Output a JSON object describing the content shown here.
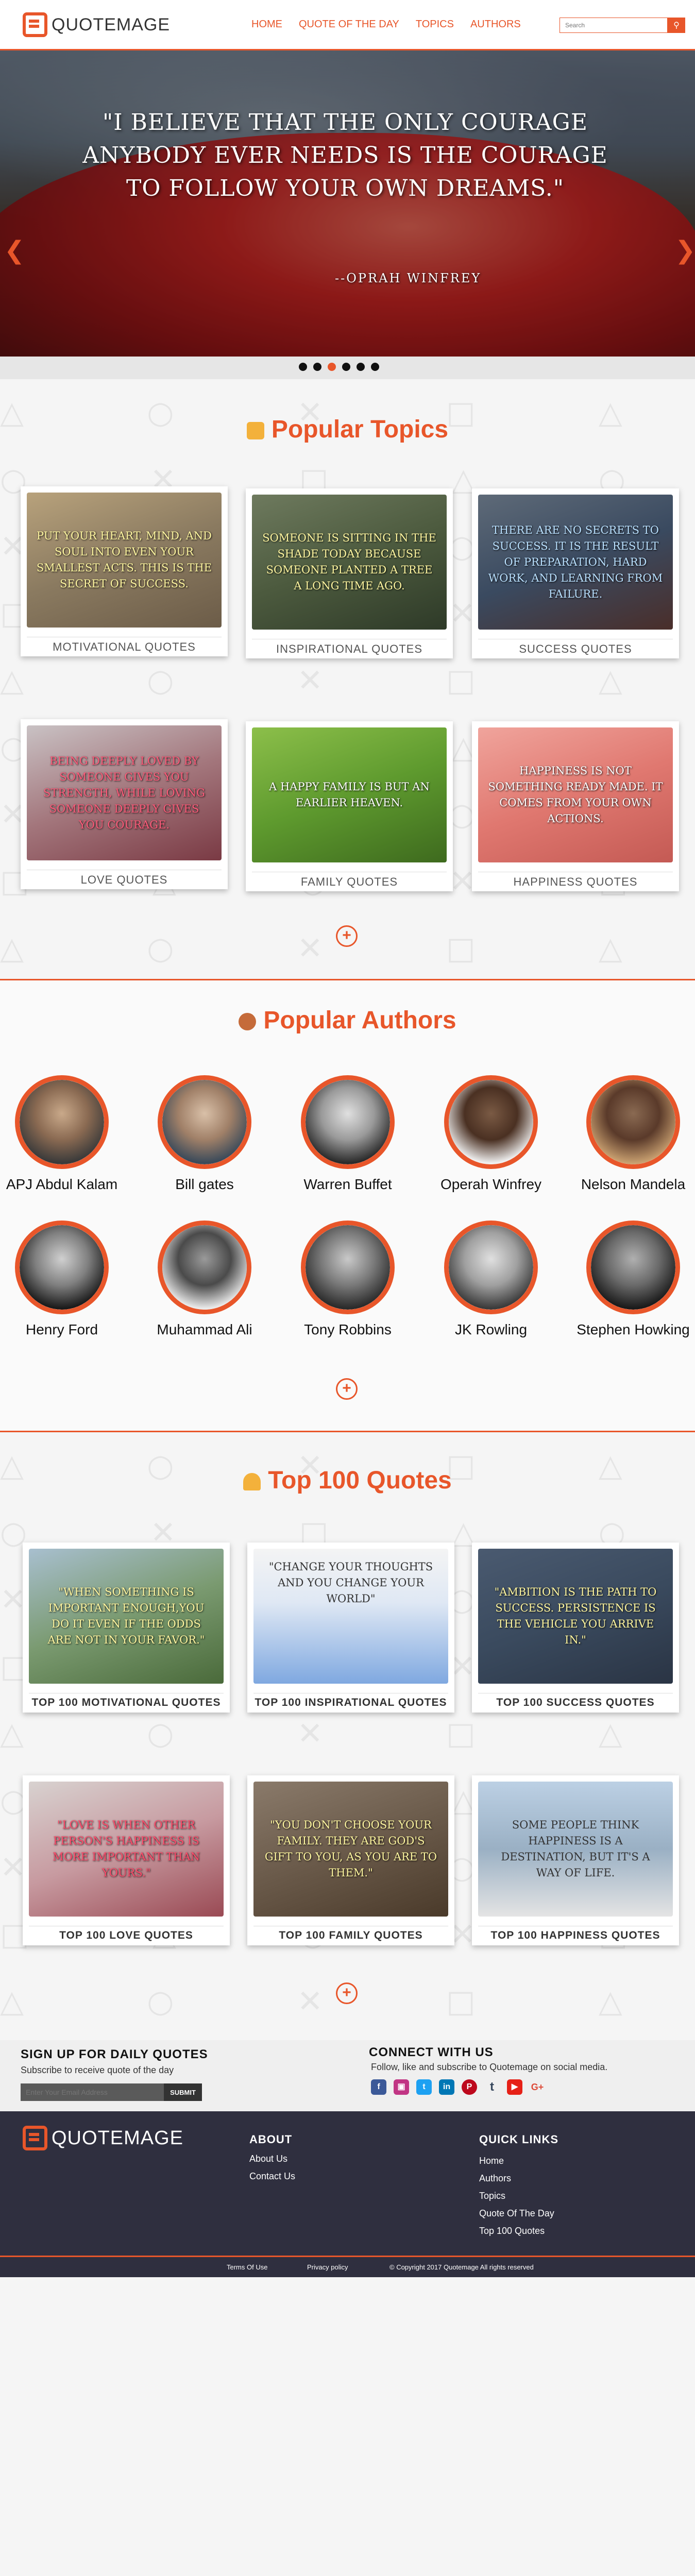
{
  "header": {
    "brand": "QUOTEMAGE",
    "nav": [
      "HOME",
      "QUOTE OF THE DAY",
      "TOPICS",
      "AUTHORS"
    ],
    "search_placeholder": "Search",
    "search_icon": "search-icon"
  },
  "hero": {
    "quote": "\"I BELIEVE THAT THE ONLY COURAGE ANYBODY EVER NEEDS IS THE COURAGE TO FOLLOW YOUR OWN DREAMS.\"",
    "author": "--OPRAH WINFREY",
    "slides_count": 6,
    "active_slide": 3
  },
  "topics": {
    "title": "Popular Topics",
    "cards": [
      {
        "text": "PUT YOUR HEART, MIND, AND SOUL INTO EVEN YOUR SMALLEST ACTS. THIS IS THE SECRET OF SUCCESS.",
        "label": "MOTIVATIONAL   QUOTES"
      },
      {
        "text": "SOMEONE IS SITTING IN THE SHADE TODAY BECAUSE SOMEONE PLANTED A TREE A LONG TIME AGO.",
        "label": "INSPIRATIONAL QUOTES"
      },
      {
        "text": "THERE ARE NO SECRETS TO SUCCESS. IT IS THE RESULT OF PREPARATION, HARD WORK, AND LEARNING FROM FAILURE.",
        "label": "SUCCESS   QUOTES"
      },
      {
        "text": "BEING DEEPLY LOVED BY SOMEONE GIVES YOU STRENGTH, WHILE LOVING SOMEONE DEEPLY GIVES YOU COURAGE.",
        "label": "LOVE   QUOTES"
      },
      {
        "text": "A HAPPY FAMILY IS BUT AN EARLIER HEAVEN.",
        "label": "FAMILY   QUOTES"
      },
      {
        "text": "HAPPINESS IS NOT SOMETHING READY MADE. IT COMES FROM YOUR OWN ACTIONS.",
        "label": "HAPPINESS   QUOTES"
      }
    ]
  },
  "authors": {
    "title": "Popular Authors",
    "list": [
      "APJ Abdul Kalam",
      "Bill gates",
      "Warren Buffet",
      "Operah Winfrey",
      "Nelson Mandela",
      "Henry Ford",
      "Muhammad Ali",
      "Tony Robbins",
      "JK Rowling",
      "Stephen Howking"
    ]
  },
  "top100": {
    "title": "Top 100 Quotes",
    "cards": [
      {
        "text": "\"WHEN SOMETHING IS IMPORTANT ENOUGH,YOU DO IT EVEN IF THE ODDS ARE NOT IN YOUR FAVOR.\"",
        "label": "TOP 100 MOTIVATIONAL  QUOTES"
      },
      {
        "text": "\"CHANGE YOUR THOUGHTS AND YOU CHANGE YOUR WORLD\"",
        "label": "TOP 100 INSPIRATIONAL QUOTES"
      },
      {
        "text": "\"AMBITION IS THE PATH TO SUCCESS. PERSISTENCE IS THE VEHICLE YOU ARRIVE IN.\"",
        "label": "TOP 100 SUCCESS  QUOTES"
      },
      {
        "text": "\"LOVE IS WHEN OTHER PERSON'S HAPPINESS IS MORE IMPORTANT THAN YOURS.\"",
        "label": "TOP  100 LOVE  QUOTES"
      },
      {
        "text": "\"YOU DON'T CHOOSE YOUR FAMILY. THEY ARE GOD'S GIFT TO YOU, AS YOU ARE TO THEM.\"",
        "label": "TOP 100 FAMILY  QUOTES"
      },
      {
        "text": "SOME PEOPLE THINK HAPPINESS IS A DESTINATION, BUT IT'S A WAY OF LIFE.",
        "label": "TOP 100 HAPPINESS  QUOTES"
      }
    ]
  },
  "newsletter": {
    "title": "SIGN UP FOR DAILY QUOTES",
    "subtitle": "Subscribe  to receive quote of the day",
    "email_placeholder": "Enter Your Email Address",
    "submit": "SUBMIT"
  },
  "connect": {
    "title": "CONNECT WITH US",
    "subtitle": "Follow, like and subscribe to Quotemage  on social media.",
    "icons": [
      "facebook-icon",
      "instagram-icon",
      "twitter-icon",
      "linkedin-icon",
      "pinterest-icon",
      "tumblr-icon",
      "youtube-icon",
      "google-plus-icon"
    ]
  },
  "footer": {
    "brand": "QUOTEMAGE",
    "about_title": "ABOUT",
    "about_links": [
      "About Us",
      "Contact Us"
    ],
    "quick_title": "QUICK LINKS",
    "quick_links": [
      "Home",
      "Authors",
      "Topics",
      "Quote Of The Day",
      "Top 100 Quotes"
    ],
    "bottom": {
      "terms": "Terms Of Use",
      "privacy": "Privacy policy",
      "copyright": "©  Copyright 2017  Quotemage All rights reserved"
    }
  },
  "colors": {
    "accent": "#e8562a",
    "footer": "#2f2f3f"
  }
}
